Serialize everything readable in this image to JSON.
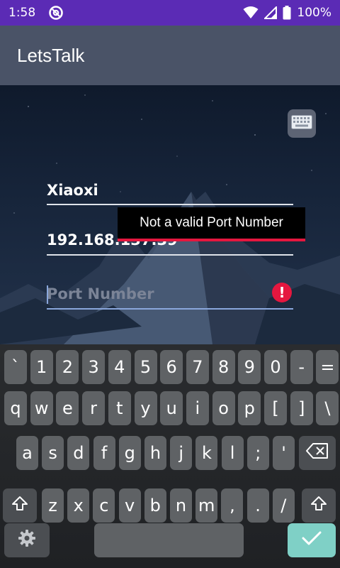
{
  "status_bar": {
    "time": "1:58",
    "battery": "100%"
  },
  "app": {
    "title": "LetsTalk"
  },
  "form": {
    "name_value": "Xiaoxi",
    "ip_value": "192.168.137.39",
    "port_placeholder": "Port Number",
    "error_icon": "!",
    "error_message": "Not a valid Port Number"
  },
  "icons": {
    "status": [
      "target-icon",
      "wifi-icon",
      "signal-icon",
      "battery-icon"
    ],
    "keyboard_toggle": "keyboard-icon",
    "error": "error-icon",
    "shift": "shift-icon",
    "backspace": "backspace-icon",
    "settings": "gear-icon",
    "enter": "check-icon"
  },
  "keyboard": {
    "row1": [
      "`",
      "1",
      "2",
      "3",
      "4",
      "5",
      "6",
      "7",
      "8",
      "9",
      "0",
      "-",
      "="
    ],
    "row2": [
      "q",
      "w",
      "e",
      "r",
      "t",
      "y",
      "u",
      "i",
      "o",
      "p",
      "[",
      "]",
      "\\"
    ],
    "row3": [
      "a",
      "s",
      "d",
      "f",
      "g",
      "h",
      "j",
      "k",
      "l",
      ";",
      "'"
    ],
    "row4": [
      "z",
      "x",
      "c",
      "v",
      "b",
      "n",
      "m",
      ",",
      ".",
      "/"
    ]
  },
  "colors": {
    "status_bar": "#5b2bb5",
    "app_bar": "#4a5367",
    "error": "#e5173f",
    "enter_key": "#7fd0c6"
  }
}
